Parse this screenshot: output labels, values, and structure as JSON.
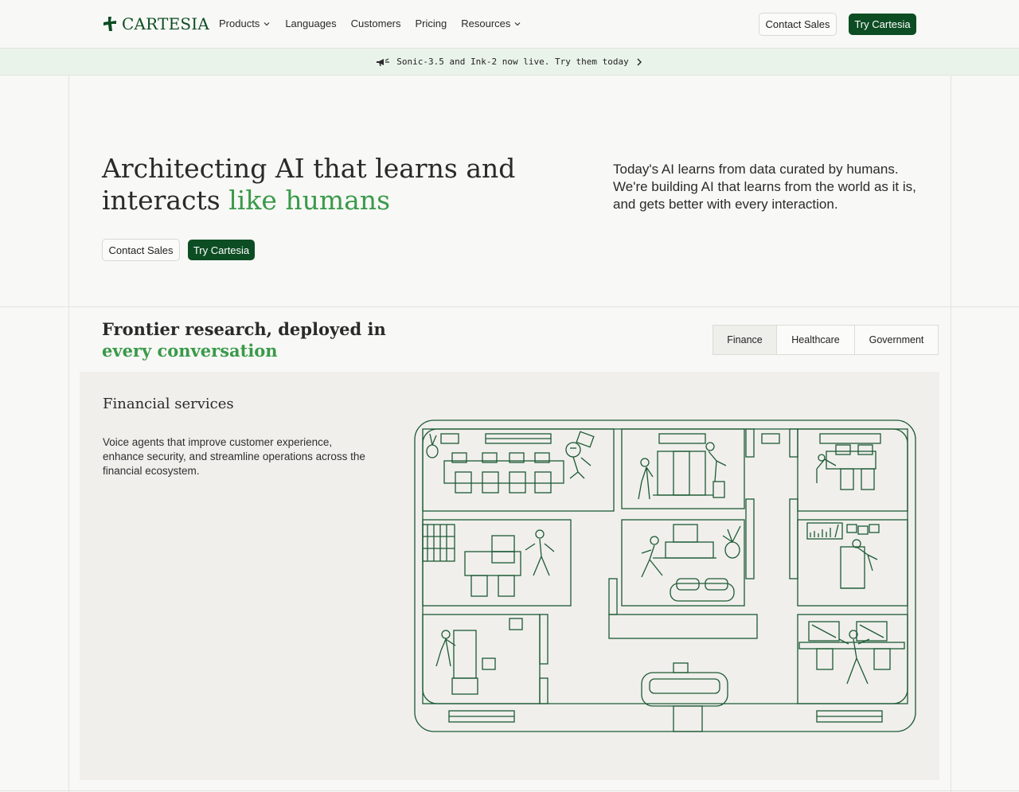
{
  "header": {
    "logo_text": "CARTESIA",
    "nav": [
      {
        "label": "Products",
        "has_dropdown": true
      },
      {
        "label": "Languages",
        "has_dropdown": false
      },
      {
        "label": "Customers",
        "has_dropdown": false
      },
      {
        "label": "Pricing",
        "has_dropdown": false
      },
      {
        "label": "Resources",
        "has_dropdown": true
      }
    ],
    "contact_sales": "Contact Sales",
    "try_cartesia": "Try Cartesia"
  },
  "announcement": {
    "icon": "megaphone-icon",
    "text": "Sonic-3.5 and Ink-2 now live. Try them today"
  },
  "hero": {
    "title_part1": "Architecting AI that learns and interacts ",
    "title_accent": "like humans",
    "description": "Today's AI learns from data curated by humans. We're building AI that learns from the world as it is, and gets better with every interaction.",
    "contact_sales": "Contact Sales",
    "try_cartesia": "Try Cartesia"
  },
  "section": {
    "title_part1": "Frontier research, deployed in ",
    "title_accent": "every conversation",
    "tabs": [
      {
        "label": "Finance",
        "active": true
      },
      {
        "label": "Healthcare",
        "active": false
      },
      {
        "label": "Government",
        "active": false
      }
    ],
    "card": {
      "title": "Financial services",
      "description": "Voice agents that improve customer experience, enhance security, and streamline operations across the financial ecosystem."
    }
  },
  "colors": {
    "brand": "#0d4d23",
    "accent": "#3a9a4a",
    "background": "#f8f8f6",
    "banner": "#eaf3ea"
  }
}
